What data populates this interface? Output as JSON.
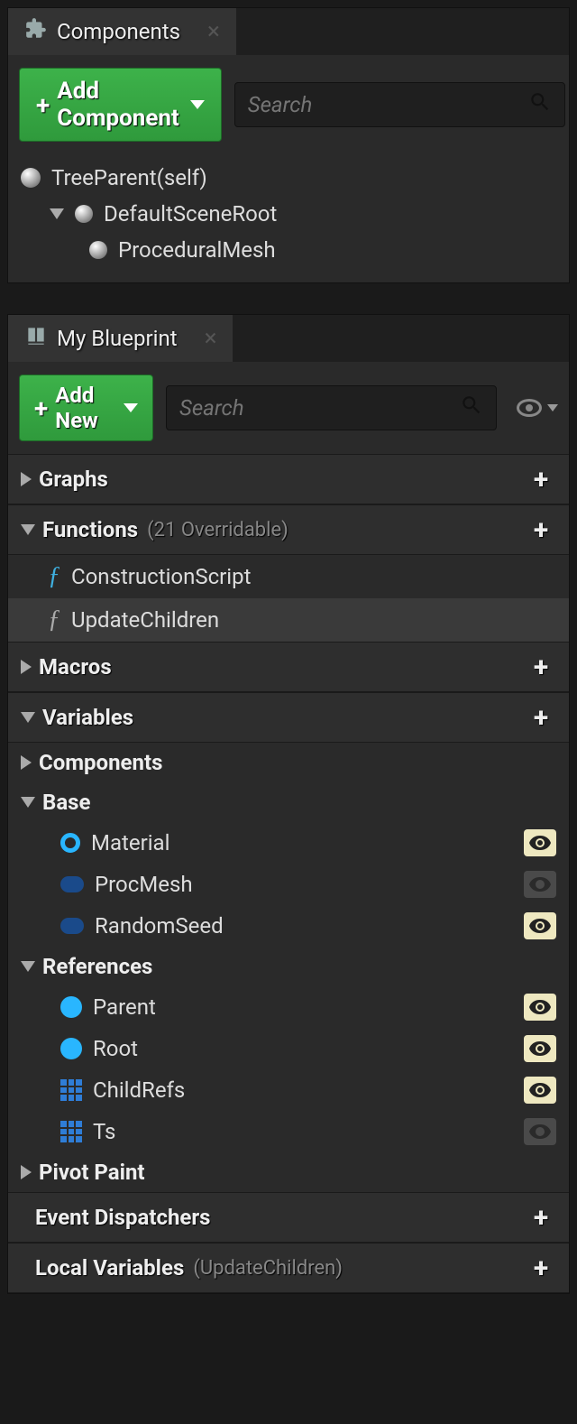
{
  "components_panel": {
    "title": "Components",
    "add_button": "Add Component",
    "search_placeholder": "Search",
    "tree": {
      "root": "TreeParent(self)",
      "scene_root": "DefaultSceneRoot",
      "child1": "ProceduralMesh"
    }
  },
  "blueprint_panel": {
    "title": "My Blueprint",
    "add_button": "Add New",
    "search_placeholder": "Search",
    "sections": {
      "graphs": "Graphs",
      "functions": "Functions",
      "functions_note": "(21 Overridable)",
      "macros": "Macros",
      "variables": "Variables",
      "event_dispatchers": "Event Dispatchers",
      "local_variables": "Local Variables",
      "local_variables_note": "(UpdateChildren)"
    },
    "functions": {
      "construction_script": "ConstructionScript",
      "update_children": "UpdateChildren"
    },
    "var_categories": {
      "components": "Components",
      "base": "Base",
      "references": "References",
      "pivot_paint": "Pivot Paint"
    },
    "vars": {
      "material": "Material",
      "proc_mesh": "ProcMesh",
      "random_seed": "RandomSeed",
      "parent": "Parent",
      "root": "Root",
      "child_refs": "ChildRefs",
      "ts": "Ts"
    }
  }
}
